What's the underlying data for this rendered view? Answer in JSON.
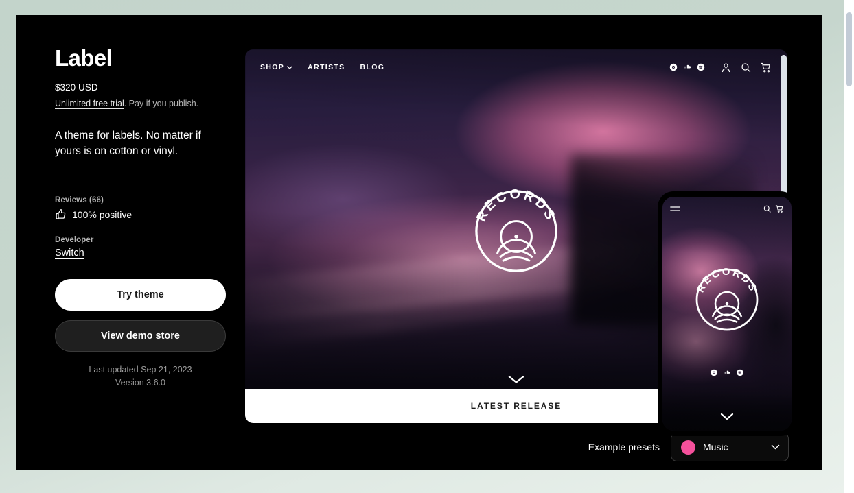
{
  "theme": {
    "title": "Label",
    "price": "$320 USD",
    "trial_link": "Unlimited free trial",
    "trial_rest": ". Pay if you publish.",
    "tagline": "A theme for labels. No matter if yours is on cotton or vinyl.",
    "reviews_label": "Reviews (66)",
    "reviews_icon": "thumbs-up-icon",
    "reviews_value": "100% positive",
    "developer_label": "Developer",
    "developer_name": "Switch",
    "try_button": "Try theme",
    "demo_button": "View demo store",
    "last_updated": "Last updated Sep 21, 2023",
    "version": "Version 3.6.0"
  },
  "preview": {
    "nav": {
      "links": [
        {
          "label": "SHOP",
          "has_caret": true,
          "icon": "chevron-down-icon"
        },
        {
          "label": "ARTISTS",
          "has_caret": false
        },
        {
          "label": "BLOG",
          "has_caret": false
        }
      ],
      "social_icons": [
        "instagram-icon",
        "soundcloud-icon",
        "spotify-icon"
      ],
      "utility_icons": [
        "account-icon",
        "search-icon",
        "cart-icon"
      ]
    },
    "logo_text": "RECORDS",
    "logo_icon": "vinyl-record-icon",
    "scroll_icon": "chevron-down-icon",
    "latest_release": "LATEST RELEASE",
    "scrollbar_icon": "scrollbar-thumb"
  },
  "phone": {
    "menu_icon": "hamburger-menu-icon",
    "utility_icons": [
      "search-icon",
      "cart-icon"
    ],
    "logo_text": "RECORDS",
    "social_icons": [
      "instagram-icon",
      "soundcloud-icon",
      "spotify-icon"
    ],
    "scroll_icon": "chevron-down-icon"
  },
  "presets": {
    "label": "Example presets",
    "value": "Music",
    "swatch_color": "#F5509B",
    "caret_icon": "chevron-down-icon"
  },
  "colors": {
    "panel_bg": "#000000",
    "page_bg": "#C3D4CB",
    "accent_pink": "#F5509B",
    "primary_button": "#FFFFFF",
    "secondary_button": "#1F1F1F"
  }
}
